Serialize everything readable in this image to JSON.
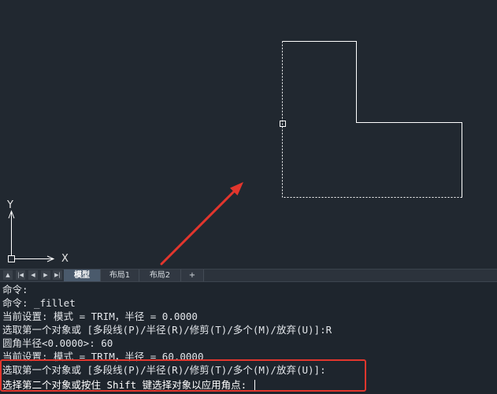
{
  "colors": {
    "canvas_bg": "#212830",
    "cad_line": "#ffffff",
    "annotation_red": "#e2362d"
  },
  "ucs": {
    "y_label": "Y",
    "x_label": "X"
  },
  "layout_tabs": {
    "nav_buttons": [
      "up-arrow-icon",
      "first-icon",
      "prev-icon",
      "next-icon",
      "last-icon"
    ],
    "tabs": [
      "模型",
      "布局1",
      "布局2",
      "+"
    ],
    "active_tab": "模型"
  },
  "command_window": {
    "history": [
      "命令:",
      "命令: _fillet",
      "当前设置: 模式 = TRIM，半径 = 0.0000",
      "选取第一个对象或 [多段线(P)/半径(R)/修剪(T)/多个(M)/放弃(U)]:R",
      "圆角半径<0.0000>: 60",
      "当前设置: 模式 = TRIM，半径 = 60.0000",
      "选取第一个对象或 [多段线(P)/半径(R)/修剪(T)/多个(M)/放弃(U)]:"
    ],
    "prompt": "选择第二个对象或按住 Shift 键选择对象以应用角点: "
  }
}
